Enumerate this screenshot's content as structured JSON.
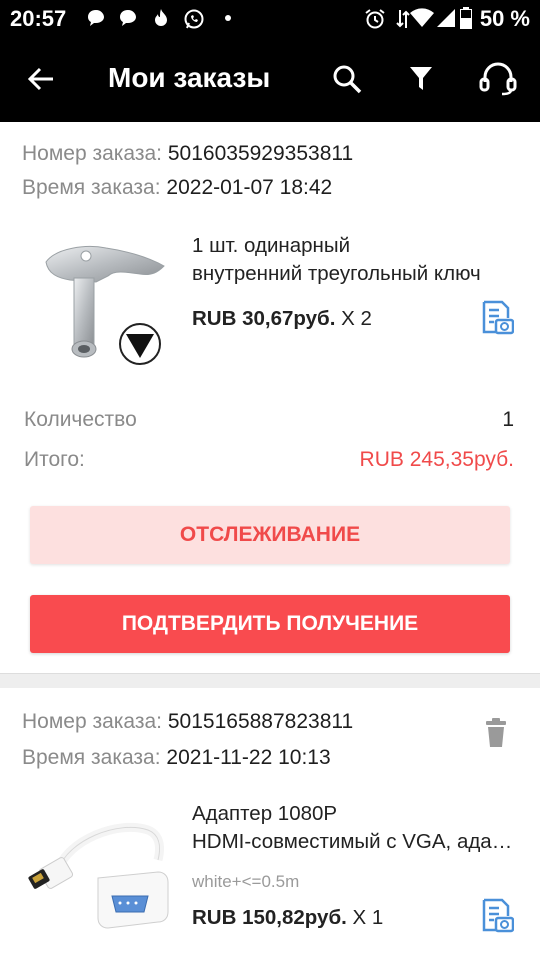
{
  "status_bar": {
    "time": "20:57",
    "battery": "50 %",
    "icons": [
      "chat-icon",
      "chat-icon",
      "fire-icon",
      "whatsapp-icon",
      "dot-icon",
      "alarm-icon",
      "wifi-icon",
      "signal-icon",
      "battery-icon"
    ]
  },
  "app_bar": {
    "title": "Мои заказы",
    "actions": [
      "search-icon",
      "filter-icon",
      "support-headset-icon"
    ]
  },
  "orders": [
    {
      "number_label": "Номер заказа:",
      "number": "5016035929353811",
      "time_label": "Время заказа:",
      "time": "2022-01-07 18:42",
      "product_line1": "1 шт. одинарный",
      "product_line2": "внутренний треугольный ключ",
      "price": "RUB 30,67руб.",
      "multiplier": "X 2",
      "quantity_label": "Количество",
      "quantity": "1",
      "total_label": "Итого:",
      "total": "RUB 245,35руб.",
      "track_button": "ОТСЛЕЖИВАНИЕ",
      "confirm_button": "ПОДТВЕРДИТЬ ПОЛУЧЕНИЕ"
    },
    {
      "number_label": "Номер заказа:",
      "number": "5015165887823811",
      "time_label": "Время заказа:",
      "time": "2021-11-22 10:13",
      "product_line1": "Адаптер 1080P",
      "product_line2": "HDMI-совместимый с VGA, адаптер",
      "variant": "white+<=0.5m",
      "price": "RUB 150,82руб.",
      "multiplier": "X 1"
    }
  ],
  "colors": {
    "accent": "#f94b4f",
    "accent_light": "#fde0df",
    "total_red": "#f04a4a",
    "icon_blue": "#4a90d9"
  }
}
